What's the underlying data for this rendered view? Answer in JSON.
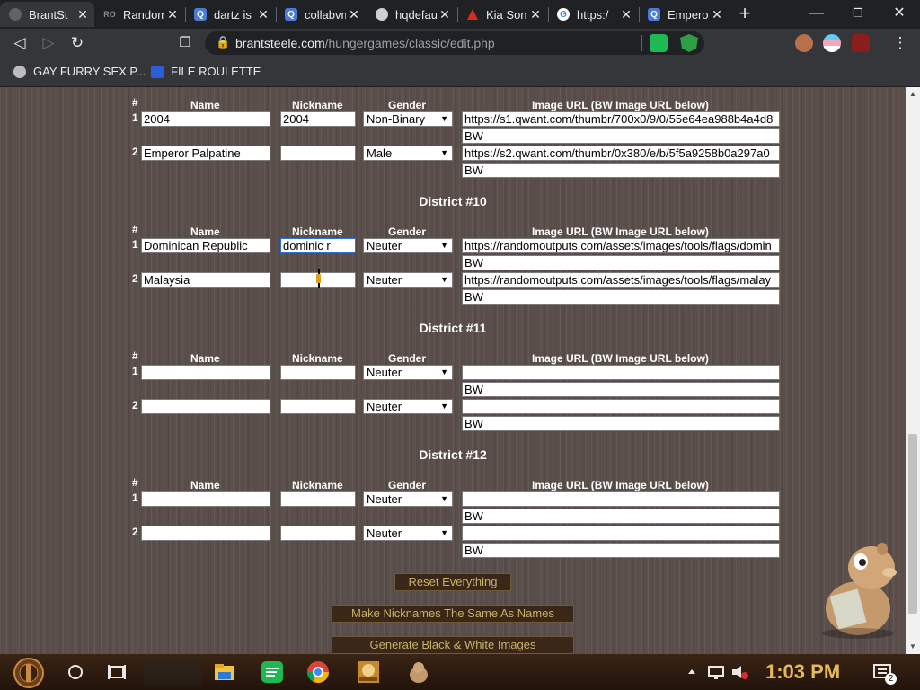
{
  "tabs": [
    {
      "title": "BrantSt",
      "favicon": "globe-icon",
      "active": true
    },
    {
      "title": "Random",
      "favicon": "ro-icon"
    },
    {
      "title": "dartz is",
      "favicon": "qwant-icon"
    },
    {
      "title": "collabvm",
      "favicon": "qwant-icon"
    },
    {
      "title": "hqdefau",
      "favicon": "globe-icon"
    },
    {
      "title": "Kia Son",
      "favicon": "kia-icon"
    },
    {
      "title": "https:/",
      "favicon": "google-icon"
    },
    {
      "title": "Emperor",
      "favicon": "qwant-icon"
    }
  ],
  "address": {
    "host": "brantsteele.com",
    "path": "/hungergames/classic/edit.php"
  },
  "bookmarks": [
    {
      "label": "GAY FURRY SEX P..."
    },
    {
      "label": "FILE ROULETTE"
    }
  ],
  "headers": {
    "num": "#",
    "name": "Name",
    "nickname": "Nickname",
    "gender": "Gender",
    "image": "Image URL (BW Image URL below)"
  },
  "top_block": {
    "rows": [
      {
        "num": "1",
        "name": "2004",
        "nickname": "2004",
        "gender": "Non-Binary",
        "image": "https://s1.qwant.com/thumbr/700x0/9/0/55e64ea988b4a4d8",
        "bw": "BW"
      },
      {
        "num": "2",
        "name": "Emperor Palpatine",
        "nickname": "",
        "gender": "Male",
        "image": "https://s2.qwant.com/thumbr/0x380/e/b/5f5a9258b0a297a0",
        "bw": "BW"
      }
    ]
  },
  "districts": [
    {
      "title": "District #10",
      "rows": [
        {
          "num": "1",
          "name": "Dominican Republic",
          "nickname": "dominic r",
          "gender": "Neuter",
          "image": "https://randomoutputs.com/assets/images/tools/flags/domin",
          "bw": "BW"
        },
        {
          "num": "2",
          "name": "Malaysia",
          "nickname": "",
          "gender": "Neuter",
          "image": "https://randomoutputs.com/assets/images/tools/flags/malay",
          "bw": "BW"
        }
      ]
    },
    {
      "title": "District #11",
      "rows": [
        {
          "num": "1",
          "name": "",
          "nickname": "",
          "gender": "Neuter",
          "image": "",
          "bw": "BW"
        },
        {
          "num": "2",
          "name": "",
          "nickname": "",
          "gender": "Neuter",
          "image": "",
          "bw": "BW"
        }
      ]
    },
    {
      "title": "District #12",
      "rows": [
        {
          "num": "1",
          "name": "",
          "nickname": "",
          "gender": "Neuter",
          "image": "",
          "bw": "BW"
        },
        {
          "num": "2",
          "name": "",
          "nickname": "",
          "gender": "Neuter",
          "image": "",
          "bw": "BW"
        }
      ]
    }
  ],
  "buttons": {
    "reset": "Reset Everything",
    "make_nicknames": "Make Nicknames The Same As Names",
    "generate_bw": "Generate Black & White Images"
  },
  "taskbar": {
    "time": "1:03 PM",
    "notifications": "2"
  }
}
